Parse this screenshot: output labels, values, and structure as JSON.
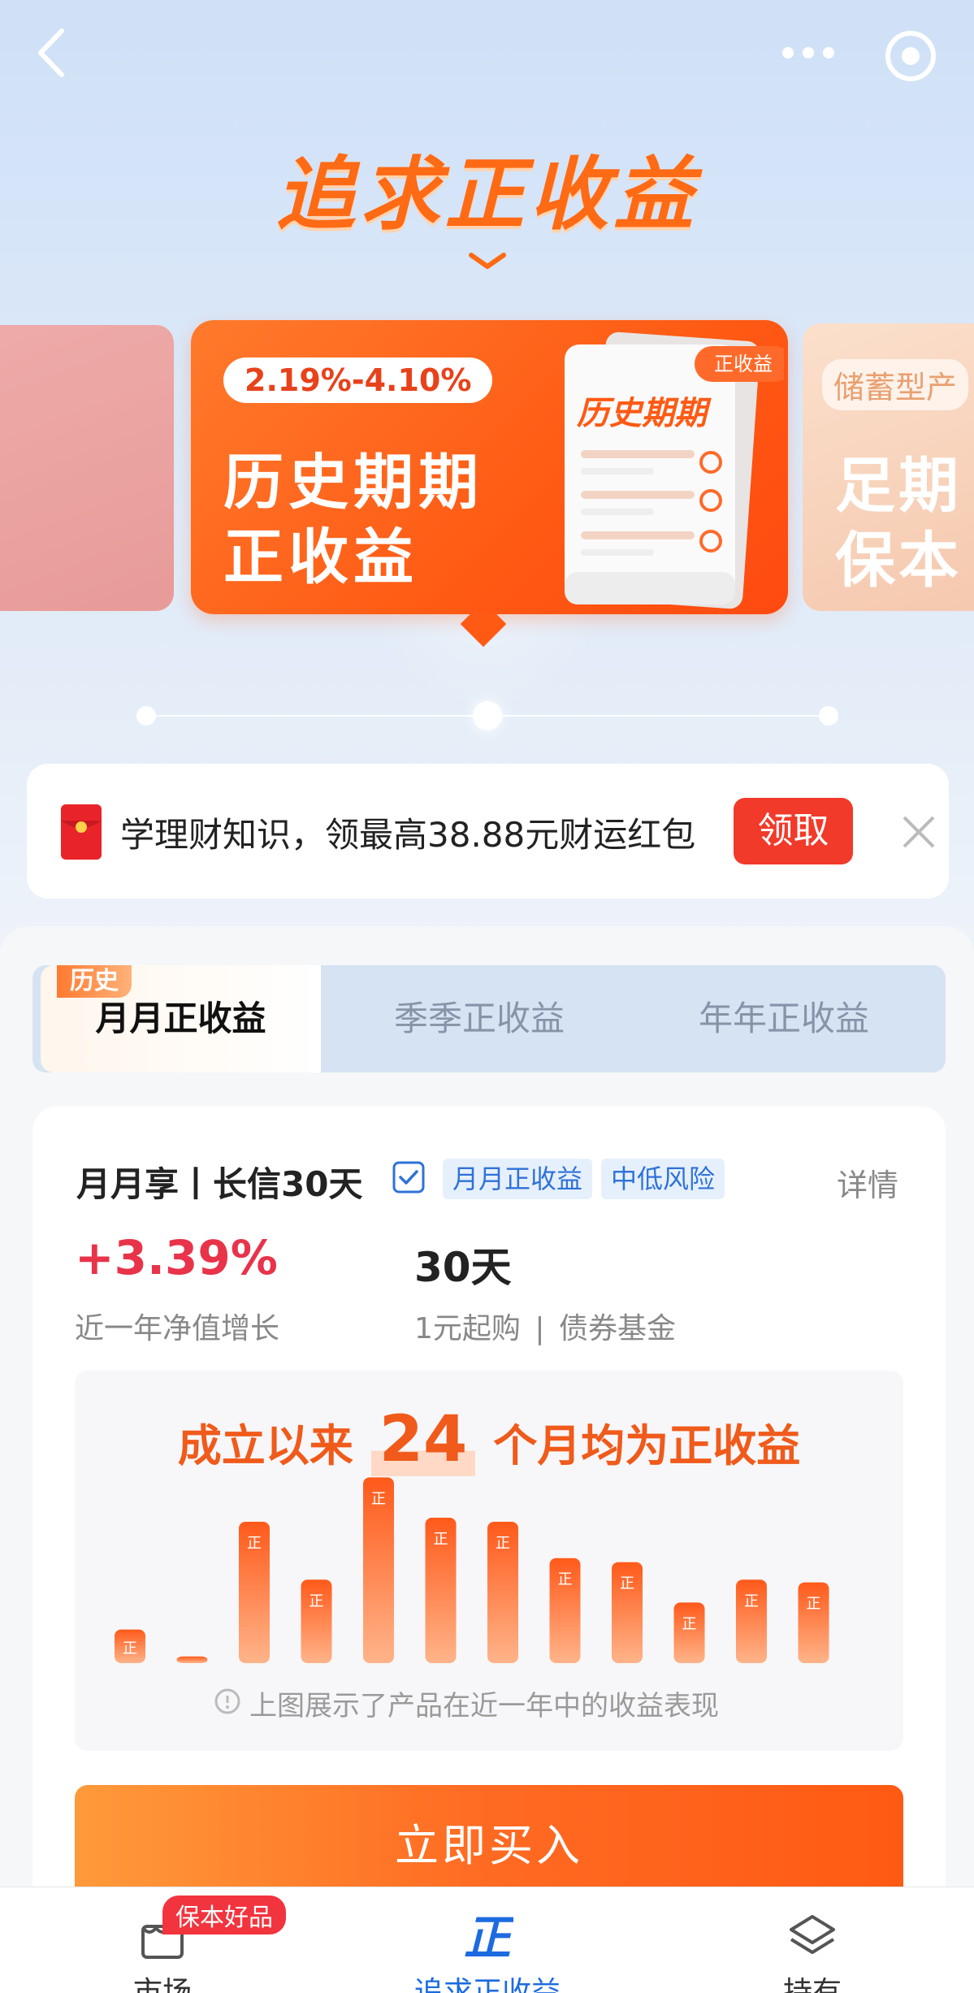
{
  "hero": {
    "title": "追求正收益"
  },
  "carousel": {
    "main": {
      "range": "2.19%-4.10%",
      "line1": "历史期期",
      "line2": "正收益",
      "paper_title": "历史期期",
      "paper_tag": "正收益"
    },
    "right": {
      "pill": "储蓄型产",
      "line1": "足期",
      "line2": "保本"
    }
  },
  "promo": {
    "text": "学理财知识，领最高38.88元财运红包",
    "button": "领取"
  },
  "tabs": {
    "tag": "历史",
    "items": [
      "月月正收益",
      "季季正收益",
      "年年正收益"
    ]
  },
  "product": {
    "name": "月月享丨长信30天",
    "tags": [
      "月月正收益",
      "中低风险"
    ],
    "detail": "详情",
    "rate": "+3.39%",
    "rate_label": "近一年净值增长",
    "period": "30天",
    "min_buy": "1元起购",
    "sep": "|",
    "fund_type": "债券基金",
    "chart_prefix": "成立以来",
    "chart_num": "24",
    "chart_suffix": "个月均为正收益",
    "bar_label": "正",
    "note": "上图展示了产品在近一年中的收益表现",
    "buy": "立即买入"
  },
  "chart_data": {
    "type": "bar",
    "values": [
      0.25,
      0.05,
      1.05,
      0.62,
      1.38,
      1.08,
      1.05,
      0.78,
      0.75,
      0.45,
      0.62,
      0.6
    ],
    "ylim": [
      0,
      1.4
    ]
  },
  "nav": {
    "badge": "保本好品",
    "items": [
      "市场",
      "追求正收益",
      "持有"
    ]
  },
  "colors": {
    "brand_orange": "#ff5a14",
    "active_blue": "#1c6be0",
    "rate_red": "#e8334a"
  }
}
